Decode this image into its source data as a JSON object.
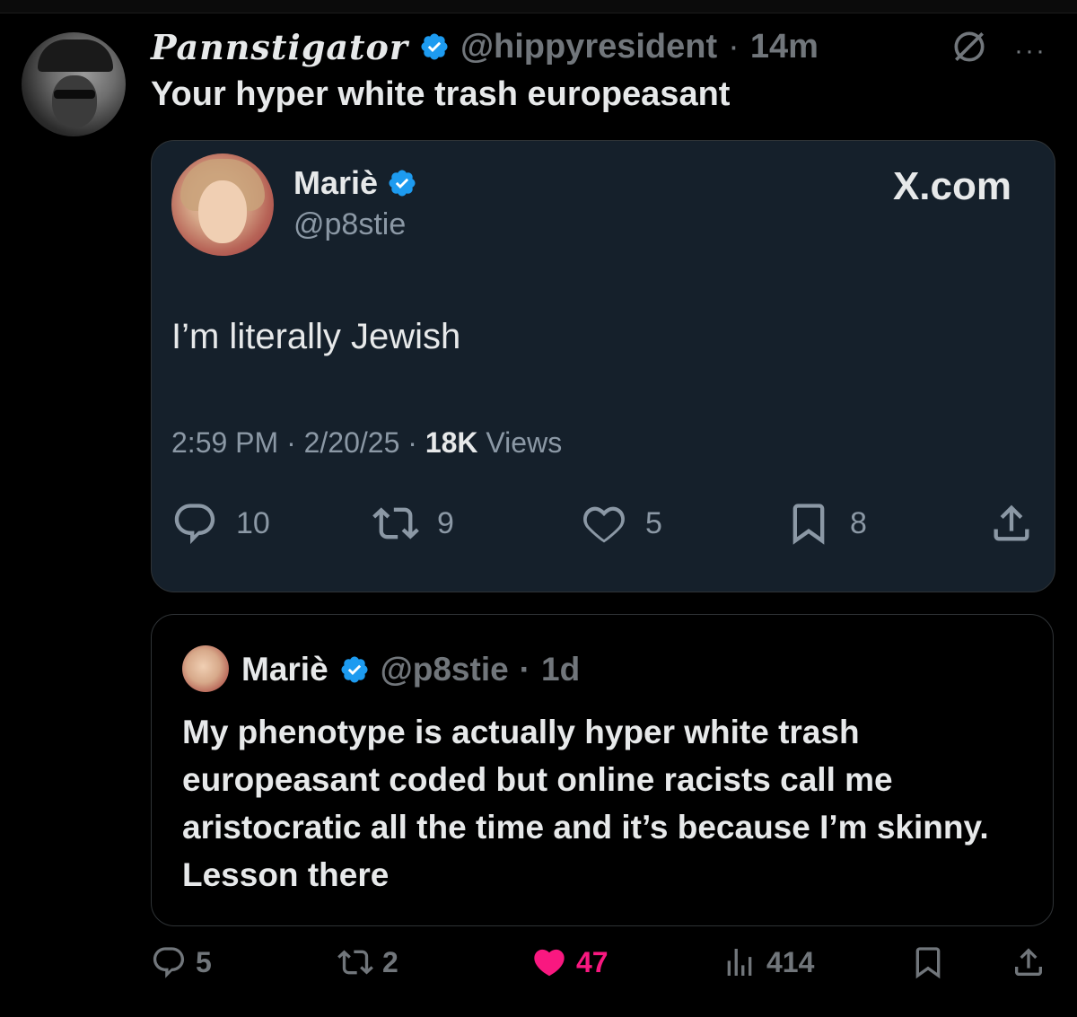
{
  "post": {
    "display_name": "Pannstigator",
    "handle": "@hippyresident",
    "separator": "·",
    "time": "14m",
    "text": "Your hyper white trash europeasant",
    "more": "···"
  },
  "card": {
    "name": "Mariè",
    "handle": "@p8stie",
    "brand": "X.com",
    "text": "I’m literally Jewish",
    "time": "2:59 PM",
    "sep1": "·",
    "date": "2/20/25",
    "sep2": "·",
    "views_count": "18K",
    "views_label": "Views",
    "replies": "10",
    "retweets": "9",
    "likes": "5",
    "bookmarks": "8"
  },
  "quote": {
    "name": "Mariè",
    "handle": "@p8stie",
    "separator": "·",
    "time": "1d",
    "text": "My phenotype is actually hyper white trash europeasant coded but online racists call me aristocratic all the time and it’s because I’m skinny. Lesson there"
  },
  "actions": {
    "replies": "5",
    "reposts": "2",
    "likes": "47",
    "views": "414"
  },
  "icons": [
    "verified-icon",
    "grok-icon",
    "more-icon",
    "reply-icon",
    "retweet-icon",
    "heart-icon",
    "bookmark-icon",
    "share-icon",
    "views-icon"
  ],
  "colors": {
    "verified": "#1d9bf0",
    "like": "#f91880",
    "card_bg": "#15202b",
    "muted": "#71767b"
  }
}
